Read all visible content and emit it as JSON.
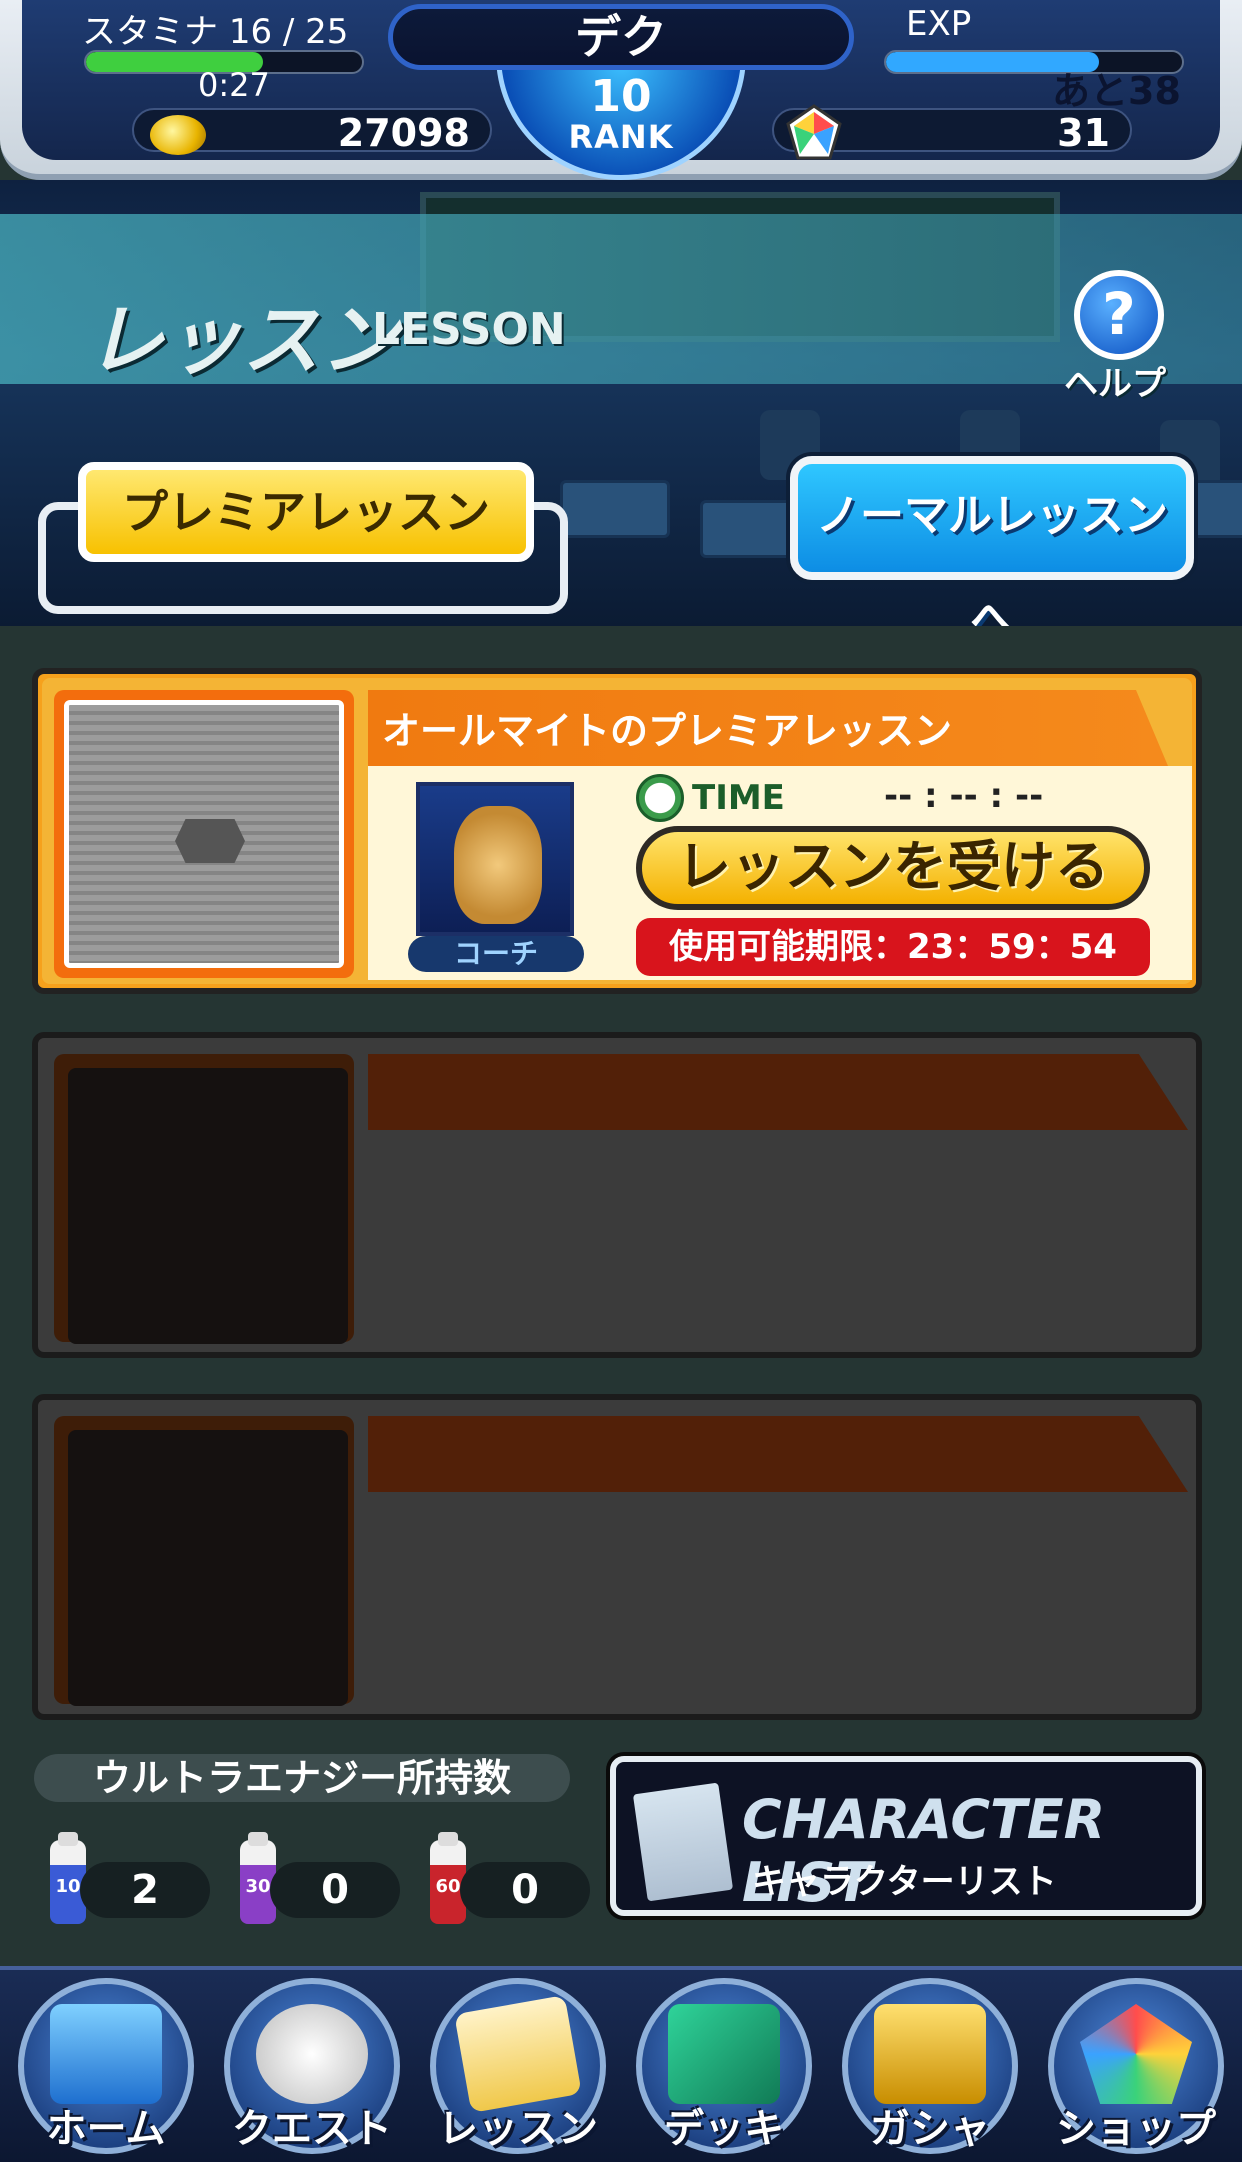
{
  "header": {
    "stamina_label": "スタミナ",
    "stamina_value": "16 / 25",
    "stamina_fraction": 0.64,
    "stamina_timer": "0:27",
    "coins": "27098",
    "player_name": "デク",
    "rank_number": "10",
    "rank_label": "RANK",
    "exp_label": "EXP",
    "exp_fraction": 0.72,
    "exp_remaining": "あと38",
    "gems": "31"
  },
  "banner": {
    "title_jp": "レッスン",
    "title_en": "LESSON",
    "help_symbol": "?",
    "help_label": "ヘルプ"
  },
  "tabs": {
    "premium": "プレミアレッスン",
    "normal": "ノーマルレッスンへ"
  },
  "lesson_slots": [
    {
      "title": "オールマイトのプレミアレッスン",
      "coach_label": "コーチ",
      "time_label": "TIME",
      "time_value": "-- : -- : --",
      "button_label": "レッスンを受ける",
      "limit": "使用可能期限：23：59：54"
    }
  ],
  "energy": {
    "heading": "ウルトラエナジー所持数",
    "items": [
      {
        "size": "10",
        "count": "2",
        "color": "#3a5bd6"
      },
      {
        "size": "30",
        "count": "0",
        "color": "#8a3fc6"
      },
      {
        "size": "60",
        "count": "0",
        "color": "#c9242c"
      }
    ]
  },
  "character_list": {
    "title_en": "CHARACTER LIST",
    "title_jp": "キャラクターリスト"
  },
  "nav": [
    {
      "label": "ホーム",
      "icon": "home-icon"
    },
    {
      "label": "クエスト",
      "icon": "quest-fist-icon"
    },
    {
      "label": "レッスン",
      "icon": "lesson-clipboard-icon"
    },
    {
      "label": "デッキ",
      "icon": "deck-cards-icon"
    },
    {
      "label": "ガシャ",
      "icon": "gacha-case-icon"
    },
    {
      "label": "ショップ",
      "icon": "shop-gem-icon"
    }
  ],
  "colors": {
    "stamina_bar": "#3fcf3f",
    "exp_bar": "#31a8ff",
    "premium_tab": "#f7c100",
    "normal_tab": "#1aa8f0",
    "take_button": "#f4b100",
    "limit_bg": "#d8141c"
  }
}
